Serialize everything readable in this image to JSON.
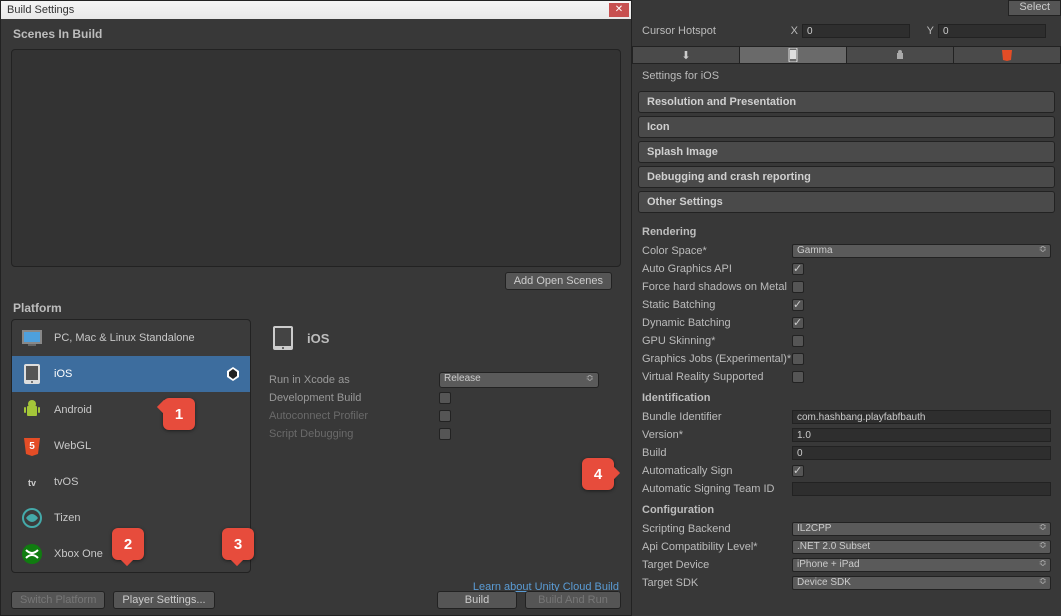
{
  "dialog": {
    "title": "Build Settings",
    "scenes_header": "Scenes In Build",
    "add_scenes": "Add Open Scenes",
    "platform_header": "Platform",
    "platforms": [
      {
        "label": "PC, Mac & Linux Standalone"
      },
      {
        "label": "iOS",
        "selected": true
      },
      {
        "label": "Android"
      },
      {
        "label": "WebGL"
      },
      {
        "label": "tvOS"
      },
      {
        "label": "Tizen"
      },
      {
        "label": "Xbox One"
      }
    ],
    "detail": {
      "title": "iOS",
      "run_as_label": "Run in Xcode as",
      "run_as_value": "Release",
      "dev_build": "Development Build",
      "autoconnect": "Autoconnect Profiler",
      "script_debug": "Script Debugging"
    },
    "cloud_link": "Learn about Unity Cloud Build",
    "buttons": {
      "switch": "Switch Platform",
      "player": "Player Settings...",
      "build": "Build",
      "build_run": "Build And Run"
    }
  },
  "inspector": {
    "select": "Select",
    "cursor_label": "Cursor Hotspot",
    "cursor_x": "0",
    "cursor_y": "0",
    "settings_for": "Settings for iOS",
    "foldouts": {
      "res": "Resolution and Presentation",
      "icon": "Icon",
      "splash": "Splash Image",
      "debug": "Debugging and crash reporting",
      "other": "Other Settings"
    },
    "rendering": {
      "head": "Rendering",
      "color_space_l": "Color Space*",
      "color_space_v": "Gamma",
      "auto_gfx": "Auto Graphics API",
      "force_shadows": "Force hard shadows on Metal",
      "static_batch": "Static Batching",
      "dyn_batch": "Dynamic Batching",
      "gpu_skin": "GPU Skinning*",
      "gfx_jobs": "Graphics Jobs (Experimental)*",
      "vr": "Virtual Reality Supported"
    },
    "ident": {
      "head": "Identification",
      "bundle_l": "Bundle Identifier",
      "bundle_v": "com.hashbang.playfabfbauth",
      "version_l": "Version*",
      "version_v": "1.0",
      "build_l": "Build",
      "build_v": "0",
      "autosign": "Automatically Sign",
      "team_l": "Automatic Signing Team ID",
      "team_v": ""
    },
    "config": {
      "head": "Configuration",
      "backend_l": "Scripting Backend",
      "backend_v": "IL2CPP",
      "api_l": "Api Compatibility Level*",
      "api_v": ".NET 2.0 Subset",
      "target_l": "Target Device",
      "target_v": "iPhone + iPad",
      "sdk_l": "Target SDK",
      "sdk_v": "Device SDK"
    }
  },
  "badges": {
    "b1": "1",
    "b2": "2",
    "b3": "3",
    "b4": "4"
  }
}
